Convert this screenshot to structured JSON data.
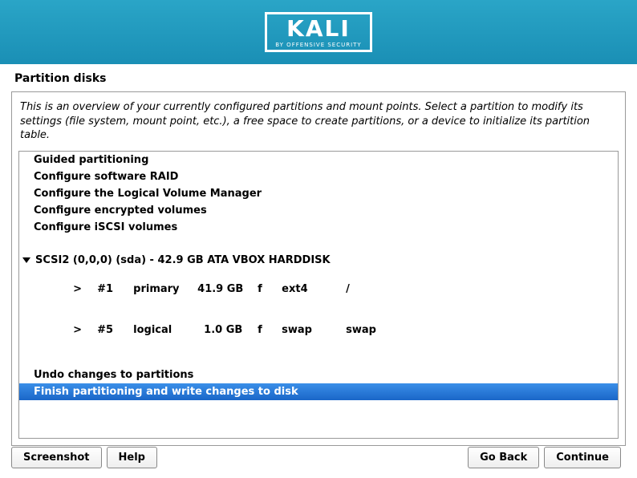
{
  "header": {
    "logo_text": "KALI",
    "logo_sub": "BY OFFENSIVE SECURITY"
  },
  "page_title": "Partition disks",
  "intro_text": "This is an overview of your currently configured partitions and mount points. Select a partition to modify its settings (file system, mount point, etc.), a free space to create partitions, or a device to initialize its partition table.",
  "options": {
    "guided": "Guided partitioning",
    "raid": "Configure software RAID",
    "lvm": "Configure the Logical Volume Manager",
    "encrypted": "Configure encrypted volumes",
    "iscsi": "Configure iSCSI volumes"
  },
  "disk": {
    "label": "SCSI2 (0,0,0) (sda) - 42.9 GB ATA VBOX HARDDISK",
    "partitions": [
      {
        "gt": ">",
        "num": "#1",
        "ptype": "primary",
        "size": "41.9 GB",
        "flag": "f",
        "fs": "ext4",
        "mount": "/"
      },
      {
        "gt": ">",
        "num": "#5",
        "ptype": "logical",
        "size": "1.0 GB",
        "flag": "f",
        "fs": "swap",
        "mount": "swap"
      }
    ]
  },
  "actions": {
    "undo": "Undo changes to partitions",
    "finish": "Finish partitioning and write changes to disk"
  },
  "buttons": {
    "screenshot": "Screenshot",
    "help": "Help",
    "goback": "Go Back",
    "continue": "Continue"
  }
}
